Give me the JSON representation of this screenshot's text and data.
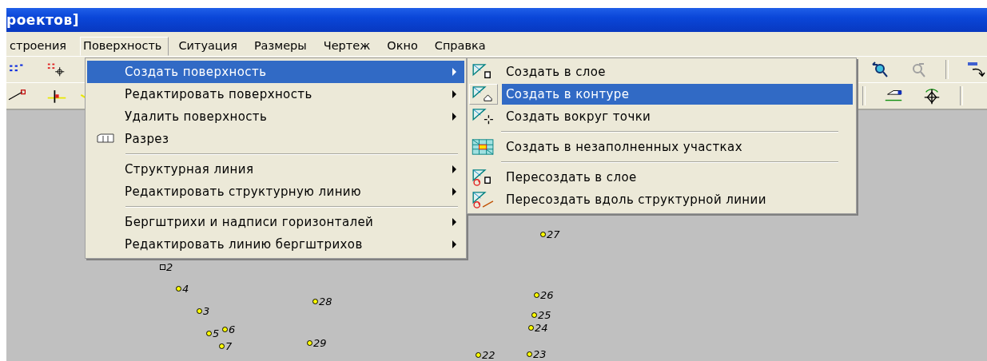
{
  "window": {
    "title": "роектов]"
  },
  "menubar": [
    {
      "label": "строения",
      "selected": false
    },
    {
      "label": "Поверхность",
      "selected": true
    },
    {
      "label": "Ситуация",
      "selected": false
    },
    {
      "label": "Размеры",
      "selected": false
    },
    {
      "label": "Чертеж",
      "selected": false
    },
    {
      "label": "Окно",
      "selected": false
    },
    {
      "label": "Справка",
      "selected": false
    }
  ],
  "menu": [
    {
      "kind": "item",
      "label": "Создать поверхность",
      "submenu": true,
      "selected": true
    },
    {
      "kind": "item",
      "label": "Редактировать поверхность",
      "submenu": true,
      "selected": false
    },
    {
      "kind": "item",
      "label": "Удалить поверхность",
      "submenu": true,
      "selected": false
    },
    {
      "kind": "item",
      "label": "Разрез",
      "submenu": false,
      "selected": false
    },
    {
      "kind": "separator"
    },
    {
      "kind": "item",
      "label": "Структурная линия",
      "submenu": true,
      "selected": false
    },
    {
      "kind": "item",
      "label": "Редактировать структурную линию",
      "submenu": true,
      "selected": false
    },
    {
      "kind": "separator"
    },
    {
      "kind": "item",
      "label": "Бергштрихи и надписи горизонталей",
      "submenu": true,
      "selected": false
    },
    {
      "kind": "item",
      "label": "Редактировать линию бергштрихов",
      "submenu": true,
      "selected": false
    }
  ],
  "submenu": [
    {
      "kind": "item",
      "label": "Создать в слое",
      "selected": false
    },
    {
      "kind": "item",
      "label": "Создать в контуре",
      "selected": true
    },
    {
      "kind": "item",
      "label": "Создать вокруг точки",
      "selected": false
    },
    {
      "kind": "separator"
    },
    {
      "kind": "item",
      "label": "Создать в незаполненных участках",
      "selected": false
    },
    {
      "kind": "separator"
    },
    {
      "kind": "item",
      "label": "Пересоздать в слое",
      "selected": false
    },
    {
      "kind": "item",
      "label": "Пересоздать вдоль структурной линии",
      "selected": false
    }
  ],
  "points": [
    {
      "label": "2"
    },
    {
      "label": "4"
    },
    {
      "label": "3"
    },
    {
      "label": "5"
    },
    {
      "label": "6"
    },
    {
      "label": "7"
    },
    {
      "label": "28"
    },
    {
      "label": "29"
    },
    {
      "label": "27"
    },
    {
      "label": "26"
    },
    {
      "label": "25"
    },
    {
      "label": "24"
    },
    {
      "label": "23"
    },
    {
      "label": "22"
    }
  ]
}
